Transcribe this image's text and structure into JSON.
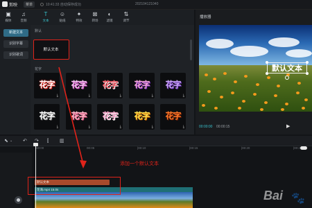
{
  "titlebar": {
    "app_name": "剪映",
    "menu_label": "菜单",
    "status": "10:41:33 自动保存成功",
    "window_title": "202104121040"
  },
  "toolbar": {
    "tools": [
      {
        "label": "媒体",
        "icon": "media-icon",
        "glyph": "▣"
      },
      {
        "label": "音频",
        "icon": "audio-icon",
        "glyph": "♫"
      },
      {
        "label": "文本",
        "icon": "text-icon",
        "glyph": "T"
      },
      {
        "label": "贴纸",
        "icon": "sticker-icon",
        "glyph": "☺"
      },
      {
        "label": "特效",
        "icon": "effects-icon",
        "glyph": "✦"
      },
      {
        "label": "转场",
        "icon": "transition-icon",
        "glyph": "⊠"
      },
      {
        "label": "滤镜",
        "icon": "filter-icon",
        "glyph": "◐"
      },
      {
        "label": "调节",
        "icon": "adjust-icon",
        "glyph": "⇅"
      }
    ]
  },
  "sidebar": {
    "items": [
      {
        "label": "新建文本"
      },
      {
        "label": "识别字幕"
      },
      {
        "label": "识别歌词"
      }
    ]
  },
  "library": {
    "default_section": "默认",
    "default_card": "默认文本",
    "fancy_section": "花字",
    "card_text": "花字",
    "download_glyph": "⤓"
  },
  "player": {
    "title": "播放器",
    "overlay_text": "默认文本",
    "current_time": "00:00:00",
    "total_time": "00:00:15",
    "play_glyph": "▶"
  },
  "timeline": {
    "ticks": [
      "00:00",
      "00:05",
      "|00:10",
      "|00:15",
      "|00:20",
      "|00:25"
    ],
    "text_clip_label": "默认文本",
    "video_clip_label": "花海.mp4 15.0s",
    "annotation": "添加一个默认文本"
  },
  "watermark": "Bai"
}
